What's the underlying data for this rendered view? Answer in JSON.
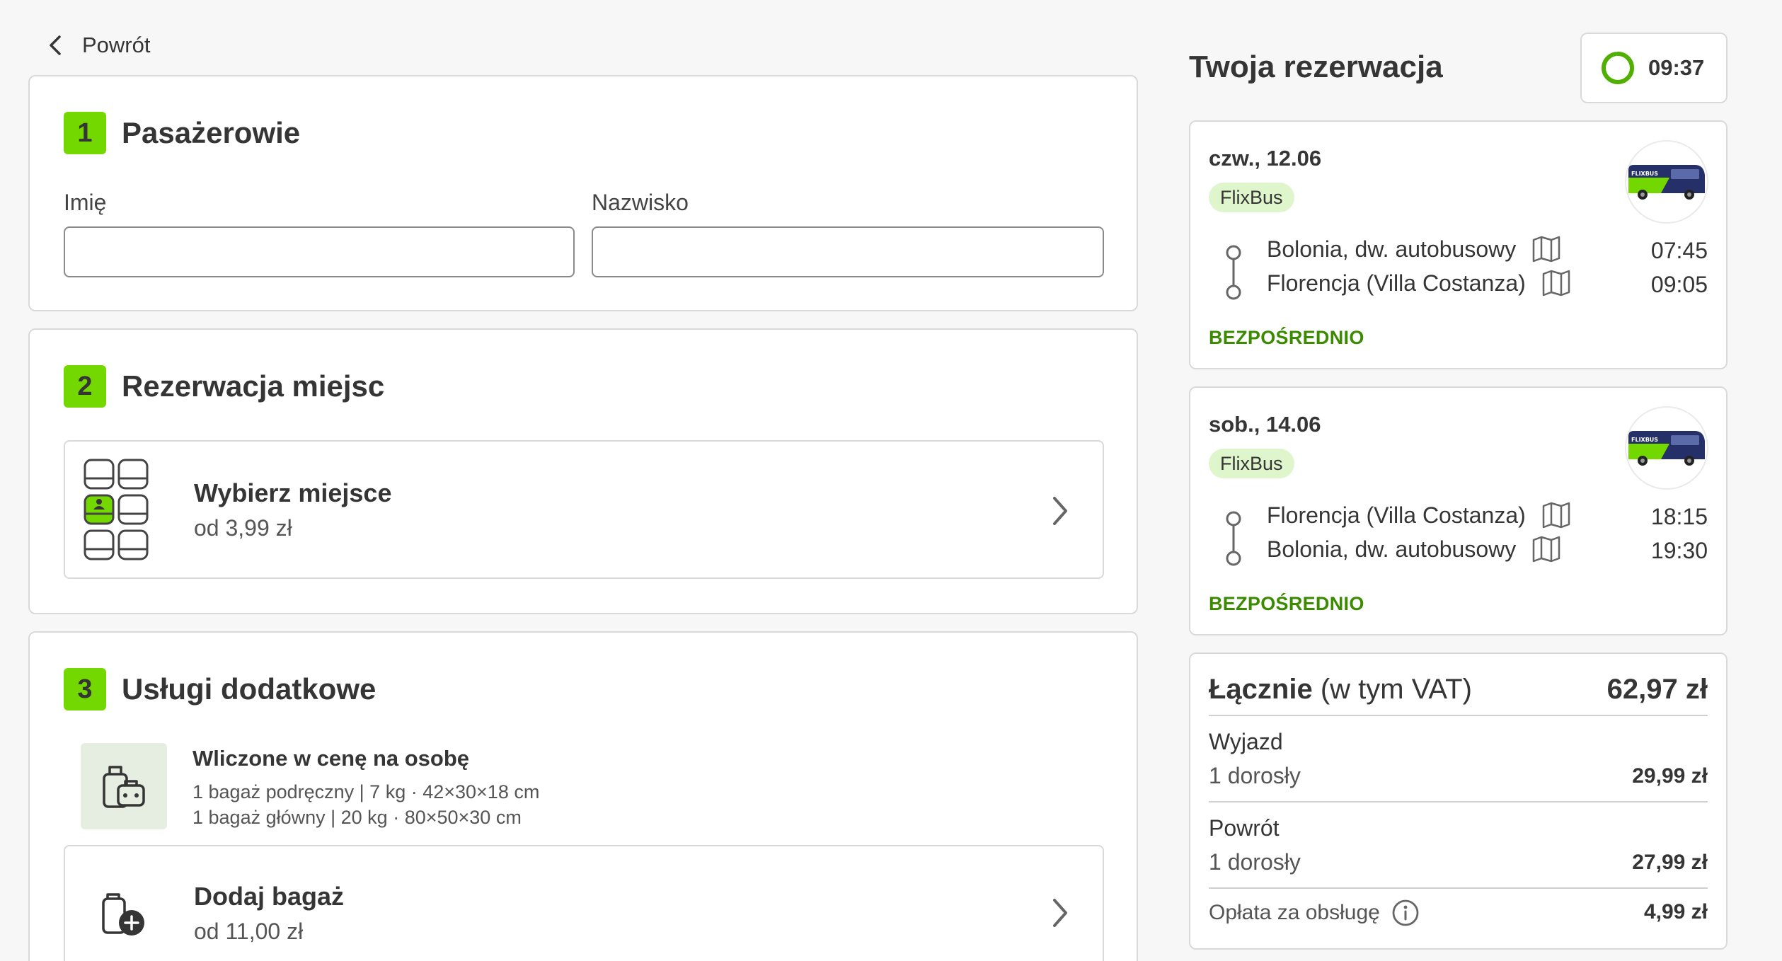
{
  "nav": {
    "back_label": "Powrót"
  },
  "sections": {
    "passengers": {
      "number": "1",
      "title": "Pasażerowie",
      "first_name_label": "Imię",
      "first_name_value": "",
      "last_name_label": "Nazwisko",
      "last_name_value": ""
    },
    "seats": {
      "number": "2",
      "title": "Rezerwacja miejsc",
      "option_title": "Wybierz miejsce",
      "option_price": "od 3,99 zł"
    },
    "extras": {
      "number": "3",
      "title": "Usługi dodatkowe",
      "included_title": "Wliczone w cenę na osobę",
      "included_lines": [
        "1 bagaż podręczny | 7 kg · 42×30×18 cm",
        "1 bagaż główny | 20 kg · 80×50×30 cm"
      ],
      "add_bag_title": "Dodaj bagaż",
      "add_bag_price": "od 11,00 zł"
    }
  },
  "reservation": {
    "title": "Twoja rezerwacja",
    "timer": "09:37",
    "timer_remaining_fraction": 0.97,
    "trips": [
      {
        "date": "czw., 12.06",
        "operator": "FlixBus",
        "from": "Bolonia, dw. autobusowy",
        "from_time": "07:45",
        "to": "Florencja (Villa Costanza)",
        "to_time": "09:05",
        "type": "BEZPOŚREDNIO"
      },
      {
        "date": "sob., 14.06",
        "operator": "FlixBus",
        "from": "Florencja (Villa Costanza)",
        "from_time": "18:15",
        "to": "Bolonia, dw. autobusowy",
        "to_time": "19:30",
        "type": "BEZPOŚREDNIO"
      }
    ],
    "summary": {
      "total_label": "Łącznie",
      "total_note": "(w tym VAT)",
      "total": "62,97 zł",
      "outbound_label": "Wyjazd",
      "outbound_pax": "1 dorosły",
      "outbound_price": "29,99 zł",
      "return_label": "Powrót",
      "return_pax": "1 dorosły",
      "return_price": "27,99 zł",
      "fee_label": "Opłata za obsługę",
      "fee_price": "4,99 zł"
    }
  },
  "colors": {
    "brand_green": "#73d700",
    "direct_green": "#3a8b00",
    "badge_green": "#dff5cc",
    "text": "#353535"
  },
  "icons": [
    "chevron-left-icon",
    "seat-map-icon",
    "chevron-right-icon",
    "luggage-icon",
    "add-luggage-icon",
    "timer-ring-icon",
    "bus-icon",
    "route-line-icon",
    "map-icon",
    "info-icon"
  ]
}
